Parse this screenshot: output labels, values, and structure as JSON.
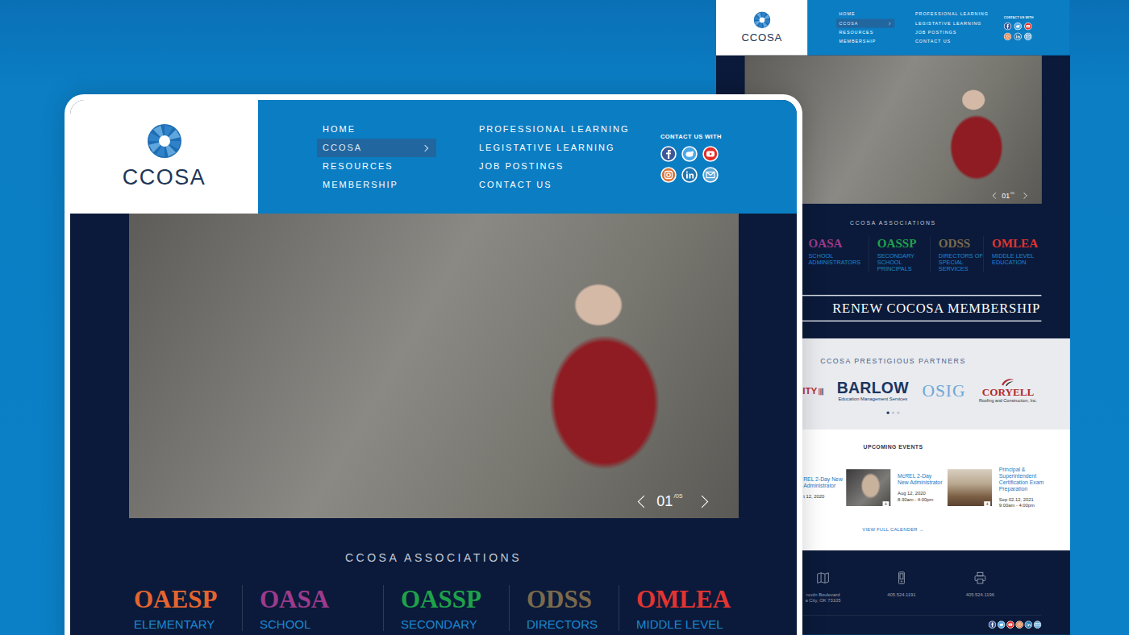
{
  "front": {
    "logo": {
      "text": "CCOSA"
    },
    "nav_primary": [
      {
        "label": "HOME",
        "selected": false
      },
      {
        "label": "CCOSA",
        "selected": true
      },
      {
        "label": "RESOURCES",
        "selected": false
      },
      {
        "label": "MEMBERSHIP",
        "selected": false
      }
    ],
    "nav_secondary": [
      {
        "label": "PROFESSIONAL LEARNING",
        "selected": false
      },
      {
        "label": "LEGISTATIVE LEARNING",
        "selected": false
      },
      {
        "label": "JOB POSTINGS",
        "selected": false
      },
      {
        "label": "CONTACT US",
        "selected": false
      }
    ],
    "contact_label": "CONTACT US WITH",
    "slider": {
      "current": "01",
      "total": "/05"
    },
    "associations_title": "CCOSA ASSOCIATIONS",
    "associations": [
      {
        "acronym": "OAESP",
        "label": "ELEMENTARY",
        "color": "#e4652f"
      },
      {
        "acronym": "OASA",
        "label": "SCHOOL",
        "color": "#9d3b8c"
      },
      {
        "acronym": "OASSP",
        "label": "SECONDARY",
        "color": "#1fa24a"
      },
      {
        "acronym": "ODSS",
        "label": "DIRECTORS",
        "color": "#7b6a4c"
      },
      {
        "acronym": "OMLEA",
        "label": "MIDDLE LEVEL",
        "color": "#e23431"
      }
    ]
  },
  "back": {
    "logo": {
      "text": "CCOSA"
    },
    "nav_primary": [
      {
        "label": "HOME",
        "selected": false
      },
      {
        "label": "CCOSA",
        "selected": true
      },
      {
        "label": "RESOURCES",
        "selected": false
      },
      {
        "label": "MEMBERSHIP",
        "selected": false
      }
    ],
    "nav_secondary": [
      {
        "label": "PROFESSIONAL LEARNING",
        "selected": false
      },
      {
        "label": "LEGISTATIVE LEARNING",
        "selected": false
      },
      {
        "label": "JOB POSTINGS",
        "selected": false
      },
      {
        "label": "CONTACT US",
        "selected": false
      }
    ],
    "contact_label": "CONTACT US WITH",
    "slider": {
      "current": "01",
      "total": "/05"
    },
    "associations_title": "CCOSA ASSOCIATIONS",
    "associations": [
      {
        "acronym": "OASA",
        "label": "SCHOOL ADMINISTRATORS",
        "color": "#9d3b8c"
      },
      {
        "acronym": "OASSP",
        "label": "SECONDARY SCHOOL PRINCIPALS",
        "color": "#1fa24a"
      },
      {
        "acronym": "ODSS",
        "label": "DIRECTORS OF SPECIAL SERVICES",
        "color": "#7b6a4c"
      },
      {
        "acronym": "OMLEA",
        "label": "MIDDLE LEVEL EDUCATION",
        "color": "#e23431"
      }
    ],
    "renew": "RENEW COCOSA MEMBERSHIP",
    "partners": {
      "title": "CCOSA PRESTIGIOUS PARTNERS",
      "logos": [
        {
          "kind": "fragment",
          "name": "ITY"
        },
        {
          "kind": "wordmark",
          "name": "BARLOW",
          "tagline": "Education Management Services"
        },
        {
          "kind": "serif",
          "name": "OSIG"
        },
        {
          "kind": "swoosh",
          "name": "CORYELL",
          "tagline": "Roofing and Construction, Inc."
        }
      ],
      "dots": [
        {
          "selected": true
        },
        {
          "selected": false
        },
        {
          "selected": false
        }
      ]
    },
    "events": {
      "title": "UPCOMING EVENTS",
      "items": [
        {
          "kind": "cut",
          "title": "REL 2-Day New Administrator",
          "date": "t 12, 2020"
        },
        {
          "kind": "full",
          "title": "McREL 2-Day New Administrator",
          "date": "Aug 12, 2020",
          "time": "8:30am - 4:00pm",
          "plus": "+"
        },
        {
          "kind": "full",
          "title": "Principal & Superintendent Certification Exam Preparation",
          "date": "Sep 02.12, 2021",
          "time": "9:00am - 4:00pm",
          "plus": "+"
        }
      ],
      "link": "VIEW FULL CALENDER →"
    },
    "footer": {
      "items": [
        {
          "lines": [
            "ncoln Boulevard",
            "a City, OK 73105"
          ]
        },
        {
          "lines": [
            "405.524.1191"
          ]
        },
        {
          "lines": [
            "405.524.1196"
          ]
        }
      ]
    }
  }
}
